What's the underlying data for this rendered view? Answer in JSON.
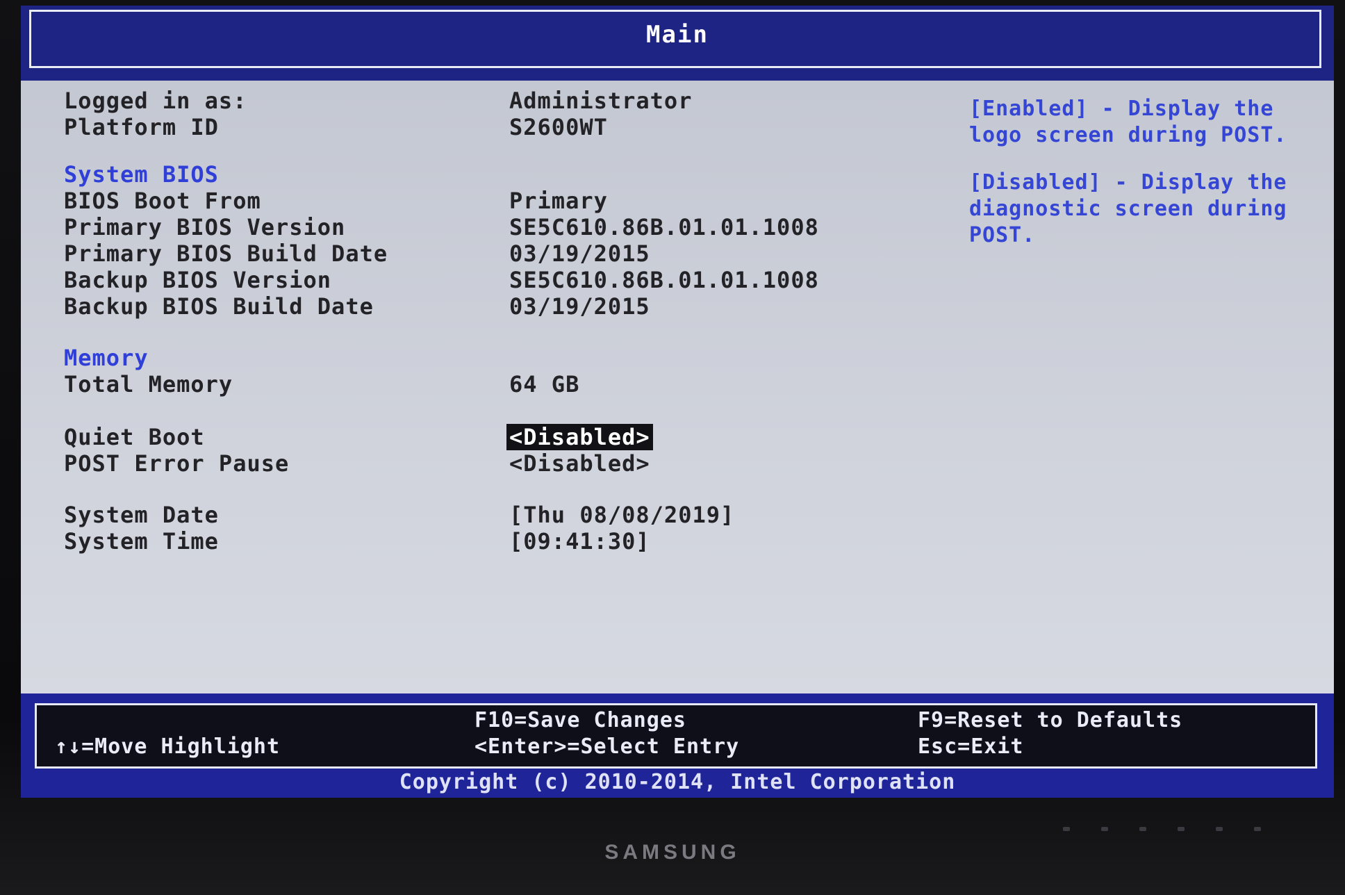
{
  "title": "Main",
  "info": [
    {
      "label": "Logged in as:",
      "value": "Administrator"
    },
    {
      "label": "Platform ID",
      "value": "S2600WT"
    }
  ],
  "system_bios": {
    "heading": "System BIOS",
    "rows": [
      {
        "label": "BIOS Boot From",
        "value": "Primary"
      },
      {
        "label": "Primary BIOS Version",
        "value": "SE5C610.86B.01.01.1008"
      },
      {
        "label": "Primary BIOS Build Date",
        "value": "03/19/2015"
      },
      {
        "label": "Backup BIOS Version",
        "value": "SE5C610.86B.01.01.1008"
      },
      {
        "label": "Backup BIOS Build Date",
        "value": "03/19/2015"
      }
    ]
  },
  "memory": {
    "heading": "Memory",
    "rows": [
      {
        "label": "Total Memory",
        "value": "64 GB"
      }
    ]
  },
  "options": [
    {
      "label": "Quiet Boot",
      "value": "<Disabled>",
      "selected": true
    },
    {
      "label": "POST Error Pause",
      "value": "<Disabled>",
      "selected": false
    }
  ],
  "datetime": [
    {
      "label": "System Date",
      "value": "[Thu 08/08/2019]"
    },
    {
      "label": "System Time",
      "value": "[09:41:30]"
    }
  ],
  "help": {
    "enabled_text": "[Enabled] - Display the logo screen during POST.",
    "disabled_text": "[Disabled] - Display the diagnostic screen during POST."
  },
  "footer": {
    "move": "↑↓=Move Highlight",
    "save": "F10=Save Changes",
    "enter": "<Enter>=Select Entry",
    "reset": "F9=Reset to Defaults",
    "exit": "Esc=Exit",
    "copyright": "Copyright (c) 2010-2014, Intel Corporation"
  },
  "monitor_brand": "SAMSUNG",
  "colors": {
    "title_bar": "#1e2484",
    "section_heading": "#2f3fd8",
    "help_text": "#3546d4",
    "content_bg": "#c8ccd6",
    "footer_bg": "#0f0f1a"
  }
}
